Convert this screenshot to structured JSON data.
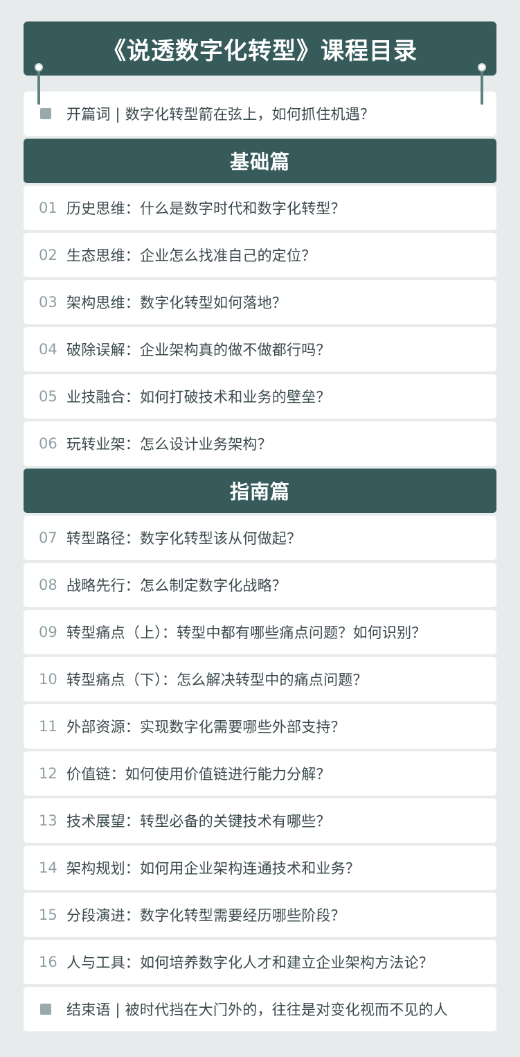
{
  "title": "《说透数字化转型》课程目录",
  "intro": {
    "text": "开篇词 | 数字化转型箭在弦上，如何抓住机遇？"
  },
  "sections": [
    {
      "label": "基础篇",
      "items": [
        {
          "num": "01",
          "text": "历史思维：什么是数字时代和数字化转型？"
        },
        {
          "num": "02",
          "text": "生态思维：企业怎么找准自己的定位？"
        },
        {
          "num": "03",
          "text": "架构思维：数字化转型如何落地？"
        },
        {
          "num": "04",
          "text": "破除误解：企业架构真的做不做都行吗？"
        },
        {
          "num": "05",
          "text": "业技融合：如何打破技术和业务的壁垒？"
        },
        {
          "num": "06",
          "text": "玩转业架：怎么设计业务架构？"
        }
      ]
    },
    {
      "label": "指南篇",
      "items": [
        {
          "num": "07",
          "text": "转型路径：数字化转型该从何做起？"
        },
        {
          "num": "08",
          "text": "战略先行：怎么制定数字化战略？"
        },
        {
          "num": "09",
          "text": "转型痛点（上）：转型中都有哪些痛点问题？如何识别？"
        },
        {
          "num": "10",
          "text": "转型痛点（下）：怎么解决转型中的痛点问题？"
        },
        {
          "num": "11",
          "text": "外部资源：实现数字化需要哪些外部支持？"
        },
        {
          "num": "12",
          "text": "价值链：如何使用价值链进行能力分解？"
        },
        {
          "num": "13",
          "text": "技术展望：转型必备的关键技术有哪些？"
        },
        {
          "num": "14",
          "text": "架构规划：如何用企业架构连通技术和业务？"
        },
        {
          "num": "15",
          "text": "分段演进：数字化转型需要经历哪些阶段？"
        },
        {
          "num": "16",
          "text": "人与工具：如何培养数字化人才和建立企业架构方法论？"
        }
      ]
    }
  ],
  "outro": {
    "text": "结束语 | 被时代挡在大门外的，往往是对变化视而不见的人"
  },
  "colors": {
    "header_bg": "#365b5a",
    "page_bg": "#e8ebec",
    "row_bg": "#ffffff",
    "number": "#8e9fa4",
    "text": "#3b4a4c",
    "bullet": "#9aa9ac"
  }
}
